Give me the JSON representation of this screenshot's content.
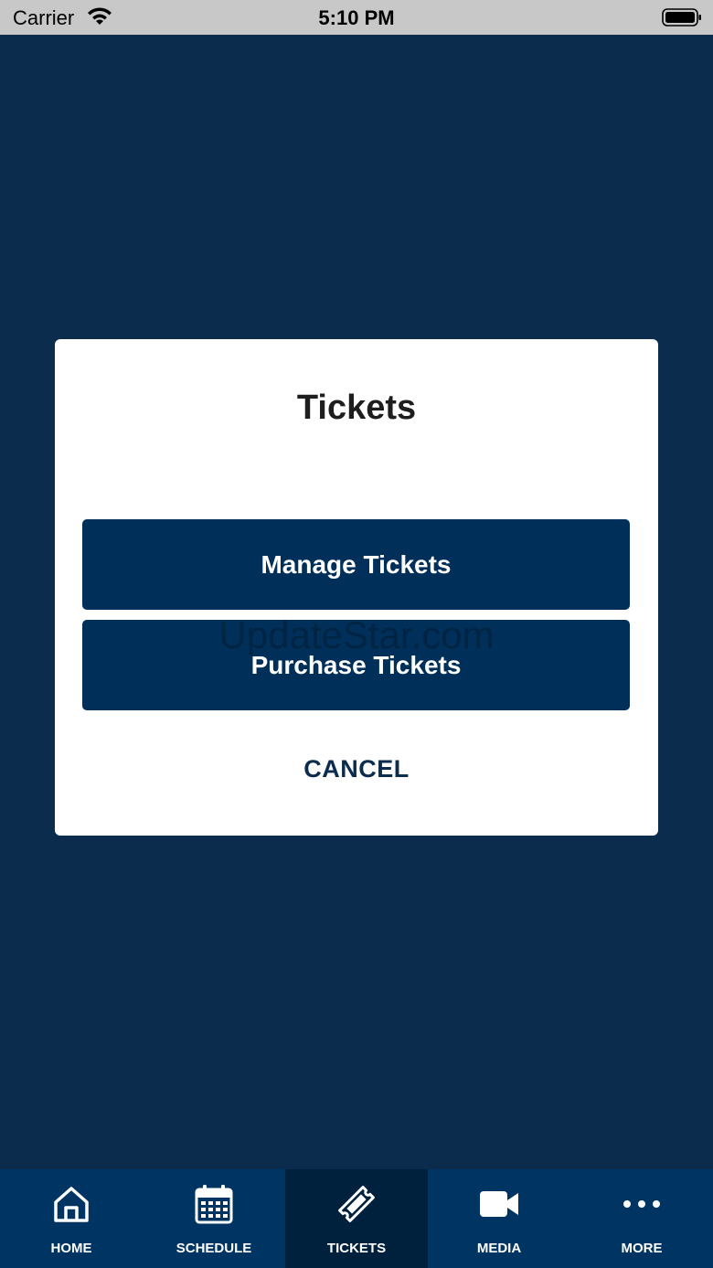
{
  "status_bar": {
    "carrier": "Carrier",
    "time": "5:10 PM"
  },
  "modal": {
    "title": "Tickets",
    "manage_label": "Manage Tickets",
    "purchase_label": "Purchase Tickets",
    "cancel_label": "CANCEL",
    "watermark": "UpdateStar.com"
  },
  "tabs": [
    {
      "label": "HOME",
      "icon": "home-icon"
    },
    {
      "label": "SCHEDULE",
      "icon": "calendar-icon"
    },
    {
      "label": "TICKETS",
      "icon": "ticket-icon",
      "active": true
    },
    {
      "label": "MEDIA",
      "icon": "video-camera-icon"
    },
    {
      "label": "MORE",
      "icon": "more-dots-icon"
    }
  ],
  "colors": {
    "background": "#0b2c4c",
    "button": "#00305a",
    "tabbar": "#003462",
    "tab_active": "#00213e"
  }
}
